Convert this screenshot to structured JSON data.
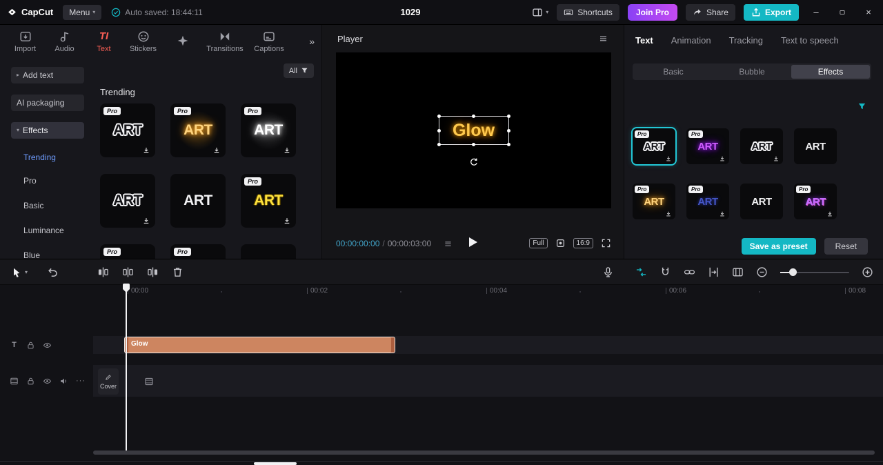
{
  "colors": {
    "accent": "#14b8c4",
    "tab-active": "#fb5f55",
    "join-pro-start": "#8a42f5",
    "join-pro-end": "#c44af1",
    "time-current": "#41a4c9",
    "trending": "#6f9dff",
    "clip": "#cd8560",
    "selected-border": "#22c7d6"
  },
  "icons": {
    "caret_down": "▾",
    "caret_right": "▸",
    "chevron_double_right": "»",
    "minimize": "–",
    "close": "×",
    "more_dots": "···",
    "text_tab_glyph": "TI",
    "text_track_glyph": "T"
  },
  "topbar": {
    "logo": "CapCut",
    "menu_label": "Menu",
    "autosave_label": "Auto saved: 18:44:11",
    "project_title": "1029",
    "shortcuts_label": "Shortcuts",
    "join_pro_label": "Join Pro",
    "share_label": "Share",
    "export_label": "Export"
  },
  "media_tabs": {
    "items": [
      {
        "label": "Import"
      },
      {
        "label": "Audio"
      },
      {
        "label": "Text",
        "active": true
      },
      {
        "label": "Stickers"
      },
      {
        "label": "Effects"
      },
      {
        "label": "Transitions"
      },
      {
        "label": "Captions"
      }
    ]
  },
  "sidebar": {
    "add_text_label": "Add text",
    "ai_packaging_label": "AI packaging",
    "effects_label": "Effects",
    "sub_items": [
      {
        "label": "Trending",
        "active": true
      },
      {
        "label": "Pro"
      },
      {
        "label": "Basic"
      },
      {
        "label": "Luminance"
      },
      {
        "label": "Blue"
      }
    ]
  },
  "library": {
    "filter_label": "All",
    "section_title": "Trending",
    "pro_badge": "Pro",
    "items": [
      {
        "text": "ART",
        "pro": true,
        "style": "sticker"
      },
      {
        "text": "ART",
        "pro": true,
        "style": "gold"
      },
      {
        "text": "ART",
        "pro": true,
        "style": "white-glow"
      },
      {
        "text": "ART",
        "pro": false,
        "style": "sticker"
      },
      {
        "text": "ART",
        "pro": false,
        "style": "plain"
      },
      {
        "text": "ART",
        "pro": true,
        "style": "yellow"
      },
      {
        "text": "",
        "pro": true,
        "style": "dark"
      },
      {
        "text": "",
        "pro": true,
        "style": "pink-glow"
      },
      {
        "text": "",
        "pro": false,
        "style": "dark"
      }
    ]
  },
  "player": {
    "title": "Player",
    "overlay_text": "Glow",
    "current_time": "00:00:00:00",
    "duration": "00:00:03:00",
    "full_label": "Full",
    "ratio_label": "16:9"
  },
  "inspector": {
    "tabs": [
      {
        "label": "Text",
        "active": true
      },
      {
        "label": "Animation"
      },
      {
        "label": "Tracking"
      },
      {
        "label": "Text to speech"
      }
    ],
    "subtabs": [
      {
        "label": "Basic"
      },
      {
        "label": "Bubble"
      },
      {
        "label": "Effects",
        "active": true
      }
    ],
    "pro_badge": "Pro",
    "presets": [
      {
        "text": "ART",
        "pro": true,
        "style": "sticker",
        "selected": true
      },
      {
        "text": "ART",
        "pro": true,
        "style": "purple"
      },
      {
        "text": "ART",
        "pro": false,
        "style": "sticker"
      },
      {
        "text": "ART",
        "pro": false,
        "style": "plain"
      },
      {
        "text": "ART",
        "pro": true,
        "style": "gold"
      },
      {
        "text": "ART",
        "pro": true,
        "style": "navy"
      },
      {
        "text": "ART",
        "pro": false,
        "style": "plain"
      },
      {
        "text": "ART",
        "pro": true,
        "style": "purple-grad"
      }
    ],
    "save_preset_label": "Save as preset",
    "reset_label": "Reset"
  },
  "timeline": {
    "ruler_labels": [
      "00:00",
      "00:02",
      "00:04",
      "00:06",
      "00:08"
    ],
    "clip_label": "Glow",
    "cover_label": "Cover"
  }
}
